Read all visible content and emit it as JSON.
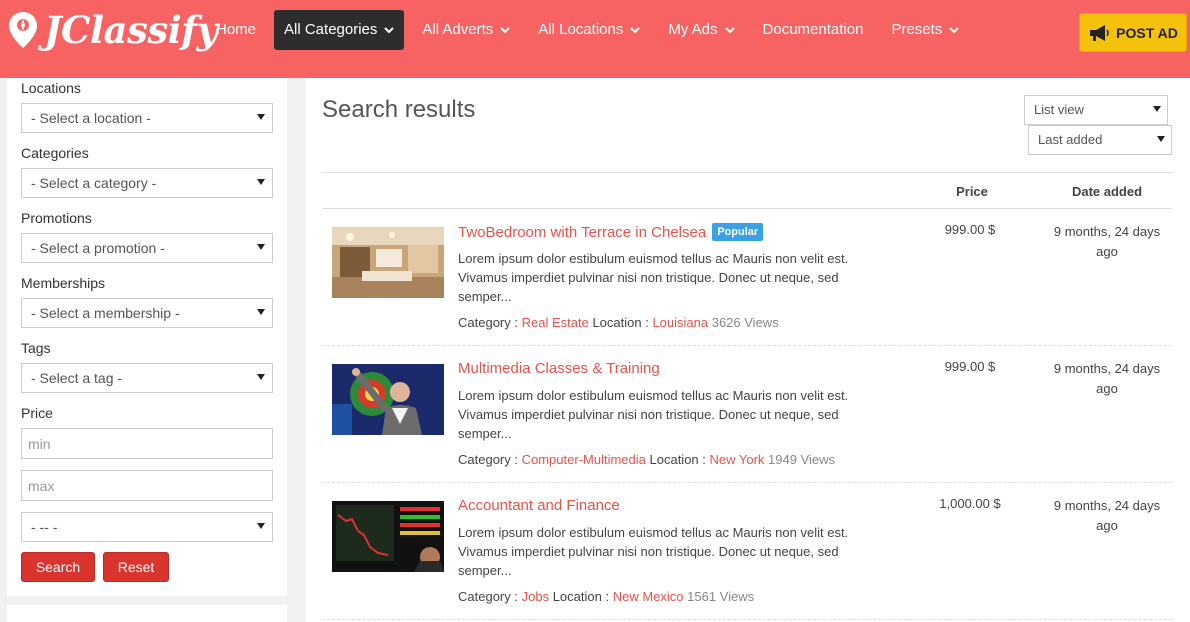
{
  "header": {
    "logo_text": "JClassify",
    "nav": [
      {
        "label": "Home",
        "has_caret": false,
        "active": false
      },
      {
        "label": "All Categories",
        "has_caret": true,
        "active": true
      },
      {
        "label": "All Adverts",
        "has_caret": true,
        "active": false
      },
      {
        "label": "All Locations",
        "has_caret": true,
        "active": false
      },
      {
        "label": "My Ads",
        "has_caret": true,
        "active": false
      },
      {
        "label": "Documentation",
        "has_caret": false,
        "active": false
      },
      {
        "label": "Presets",
        "has_caret": true,
        "active": false
      }
    ],
    "post_ad_label": "POST AD",
    "brand_color": "#f76262",
    "post_ad_color": "#f4c20d"
  },
  "sidebar": {
    "locations": {
      "label": "Locations",
      "value": "- Select a location -"
    },
    "categories": {
      "label": "Categories",
      "value": "- Select a category -"
    },
    "promotions": {
      "label": "Promotions",
      "value": "- Select a promotion -"
    },
    "memberships": {
      "label": "Memberships",
      "value": "- Select a membership -"
    },
    "tags": {
      "label": "Tags",
      "value": "- Select a tag -"
    },
    "price": {
      "label": "Price",
      "min_placeholder": "min",
      "max_placeholder": "max",
      "currency_value": "- -- -"
    },
    "search_label": "Search",
    "reset_label": "Reset"
  },
  "main": {
    "title": "Search results",
    "view_select": "List view",
    "sort_select": "Last added",
    "columns": {
      "price": "Price",
      "date": "Date added"
    },
    "labels": {
      "category": "Category :",
      "location": "Location :"
    },
    "ads": [
      {
        "title": "TwoBedroom with Terrace in Chelsea",
        "badge": "Popular",
        "description": "Lorem ipsum dolor estibulum euismod tellus ac Mauris non velit est. Vivamus imperdiet pulvinar nisi non tristique. Donec ut neque, sed semper...",
        "category": "Real Estate",
        "location": "Louisiana",
        "views": "3626 Views",
        "price": "999.00 $",
        "date": "9 months, 24 days ago",
        "thumb_icon": "apartment-photo"
      },
      {
        "title": "Multimedia Classes & Training",
        "badge": "",
        "description": "Lorem ipsum dolor estibulum euismod tellus ac Mauris non velit est. Vivamus imperdiet pulvinar nisi non tristique. Donec ut neque, sed semper...",
        "category": "Computer-Multimedia",
        "location": "New York",
        "views": "1949 Views",
        "price": "999.00 $",
        "date": "9 months, 24 days ago",
        "thumb_icon": "presenter-photo"
      },
      {
        "title": "Accountant and Finance",
        "badge": "",
        "description": "Lorem ipsum dolor estibulum euismod tellus ac Mauris non velit est. Vivamus imperdiet pulvinar nisi non tristique. Donec ut neque, sed semper...",
        "category": "Jobs",
        "location": "New Mexico",
        "views": "1561 Views",
        "price": "1,000.00 $",
        "date": "9 months, 24 days ago",
        "thumb_icon": "stock-chart-photo"
      }
    ]
  }
}
